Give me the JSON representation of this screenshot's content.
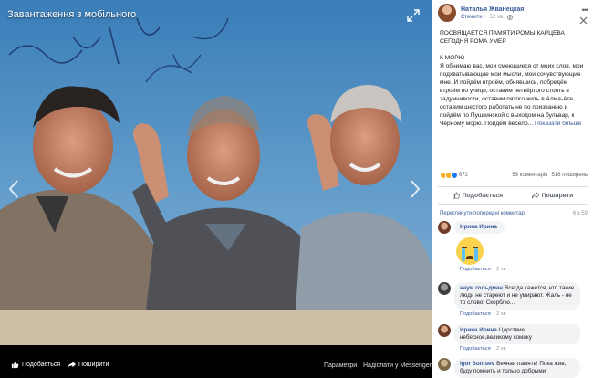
{
  "viewer": {
    "title": "Завантаження з мобільного",
    "footer": {
      "like": "Подобається",
      "share": "Поширити",
      "params": "Параметри",
      "send": "Надіслати у Messenger"
    }
  },
  "post": {
    "author": "Наталья Жванецкая",
    "follow": "Стежити",
    "time": "52 хв.",
    "lines": [
      "ПОСВЯЩАЕТСЯ ПАМЯТИ РОМЫ КАРЦЕВА СЕГОДНЯ РОМА УМЕР",
      "К МОРЮ",
      "Я обнимаю вас, мои смеющиеся от моих слов, мои подхватывающие мои мысли, мои сочувствующие мне. И пойдём втроём, обнявшись, побредём втроём по улице, оставим четвёртого стоять в задумчивости, оставим пятого жить в Алма-Ате, оставим шестого работать не по призванию и пойдём по Пушкинской с выходом на бульвар, к Чёрному морю. Пойдём весело..."
    ],
    "see_more": "Показати більше",
    "reaction_count": "672",
    "comments_count": "59 коментарів",
    "shares_count": "516 поширень",
    "like_label": "Подобається",
    "share_label": "Поширити",
    "prev_comments": "Переглянути попередні коментарі",
    "comments_position": "6 з 59"
  },
  "comments": [
    {
      "name": "Ирина Ирина",
      "text": "",
      "like": "Подобається",
      "time": "2 хв"
    },
    {
      "name": "наум гольдман",
      "text": "Всегда кажется, что такие люди не стареют и не умирают. Жаль - не то слово! Скорблю...",
      "like": "Подобається",
      "time": "2 хв"
    },
    {
      "name": "Ирина Ирина",
      "text": "Царствие небесное,великому комику",
      "like": "Подобається",
      "time": "2 хв"
    },
    {
      "name": "Igor Suntsev",
      "text": "Вечная память! Пока жив, буду помнить и только добрыми",
      "like": "",
      "time": ""
    }
  ],
  "colors": {
    "link": "#385898",
    "muted": "#90949c",
    "bubble": "#f2f3f5"
  }
}
